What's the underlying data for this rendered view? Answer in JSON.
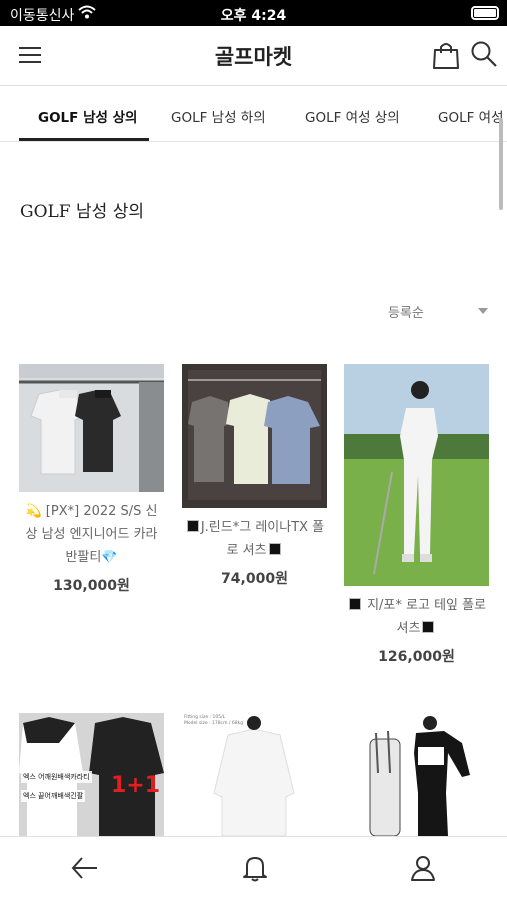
{
  "status_bar": {
    "carrier": "이동통신사",
    "time": "오후 4:24"
  },
  "header": {
    "title": "골프마켓",
    "icons": [
      "menu-icon",
      "shopping-bag-icon",
      "search-icon"
    ]
  },
  "tabs": [
    {
      "label": "GOLF 남성 상의",
      "active": true
    },
    {
      "label": "GOLF 남성 하의",
      "active": false
    },
    {
      "label": "GOLF 여성 상의",
      "active": false
    },
    {
      "label": "GOLF 여성",
      "active": false
    }
  ],
  "section": {
    "title": "GOLF 남성 상의"
  },
  "sort": {
    "selected": "등록순"
  },
  "products": [
    {
      "name_prefix_icon": "sparkle-emoji",
      "name": "[PX*] 2022 S/S 신상 남성 엔지니어드 카라 반팔티",
      "name_suffix_icon": "gem-emoji",
      "price": "130,000원"
    },
    {
      "name_prefix_icon": "black-square",
      "name": "J.린드*그 레이나TX 폴로 셔츠",
      "name_suffix_icon": "black-square",
      "price": "74,000원"
    },
    {
      "name_prefix_icon": "black-square",
      "name": "지/포* 로고 테잎 폴로 셔츠",
      "name_suffix_icon": "black-square",
      "price": "126,000원"
    },
    {
      "thumb_text_1": "엑스 어깨원배색카라티",
      "thumb_text_2": "엑스 끝어깨배색긴팔",
      "thumb_badge": "1+1"
    },
    {
      "thumb_text_1": "Fitting size : 105/L",
      "thumb_text_2": "Model size : 178cm / 68kg"
    },
    {}
  ],
  "bottom_nav": {
    "icons": [
      "back-arrow-icon",
      "bell-icon",
      "user-icon"
    ]
  },
  "colors": {
    "status_bar_bg": "#000000",
    "active_tab_underline": "#222222",
    "price_text": "#444444"
  }
}
